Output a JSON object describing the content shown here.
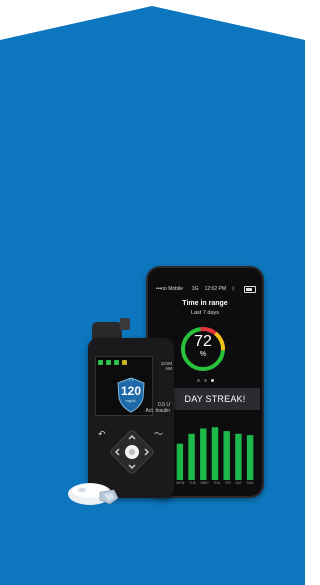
{
  "colors": {
    "banner": "#0c77be",
    "ring_green": "#27c33b",
    "ring_yellow": "#f3c21a",
    "ring_red": "#e2323a",
    "bars": "#1db94a",
    "shield": "#1e6aa8"
  },
  "phone": {
    "status": {
      "carrier": "•••oo Mobile",
      "network": "3G",
      "time": "12:02 PM",
      "bluetooth_icon": "bluetooth-icon",
      "battery_icon": "battery-icon"
    },
    "title": "Time in range",
    "subtitle": "Last 7 days",
    "percent_value": "72",
    "percent_sign": "%",
    "percent_fraction": 0.72,
    "streak_text": "DAY STREAK!",
    "bar_levels": [
      0.55,
      0.7,
      0.78,
      0.8,
      0.74,
      0.7,
      0.68
    ],
    "day_labels": [
      "MON",
      "TUE",
      "WED",
      "THU",
      "FRI",
      "SAT",
      "SUN"
    ]
  },
  "pump": {
    "time": "10:00",
    "ampm": "AM",
    "bg_value": "120",
    "bg_unit": "mg/dL",
    "arrows": "↓↓",
    "insulin_value": "0.5 U",
    "insulin_label": "Act. Insulin",
    "icons": [
      "battery-icon",
      "reservoir-icon",
      "signal-icon",
      "sensor-icon"
    ]
  }
}
